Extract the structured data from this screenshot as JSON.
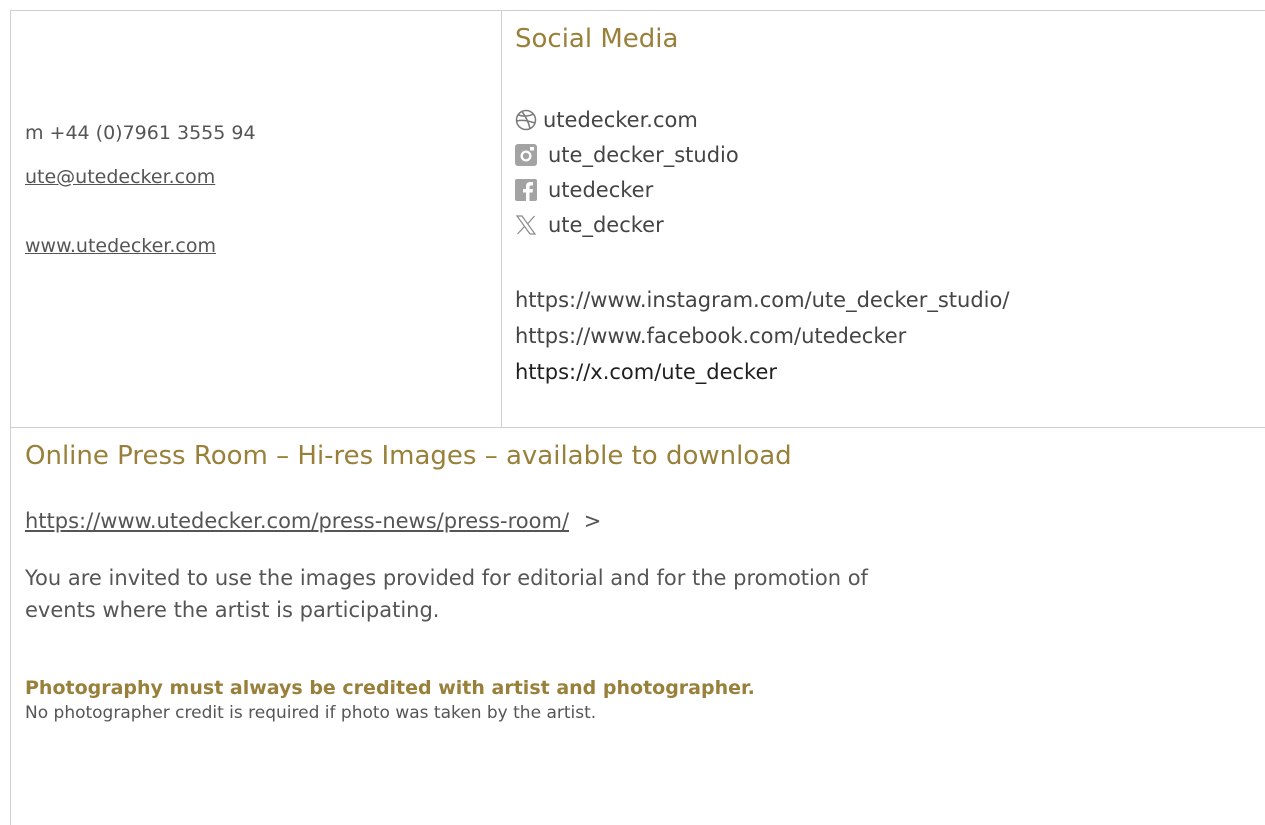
{
  "contact": {
    "phone": "m +44 (0)7961 3555 94",
    "email": "ute@utedecker.com",
    "website": "www.utedecker.com"
  },
  "social": {
    "heading": "Social Media",
    "items": [
      {
        "icon": "dribbble-icon",
        "label": "utedecker.com"
      },
      {
        "icon": "instagram-icon",
        "label": "ute_decker_studio"
      },
      {
        "icon": "facebook-icon",
        "label": "utedecker"
      },
      {
        "icon": "x-icon",
        "label": "ute_decker"
      }
    ],
    "urls": [
      "https://www.instagram.com/ute_decker_studio/",
      "https://www.facebook.com/utedecker",
      "https://x.com/ute_decker"
    ]
  },
  "press": {
    "heading": "Online Press Room – Hi-res Images – available to download",
    "link": "https://www.utedecker.com/press-news/press-room/",
    "arrow": ">",
    "paragraph_line1": "You are invited to use the images provided for editorial and for the promotion of",
    "paragraph_line2": "events where the artist is participating.",
    "credit_bold": "Photography must always be credited with artist and photographer.",
    "credit_note": "No photographer credit is required if photo was taken by the artist."
  },
  "colors": {
    "accent": "#99803a",
    "text": "#555555",
    "border": "#cfcfcf",
    "icon": "#a3a3a3"
  }
}
